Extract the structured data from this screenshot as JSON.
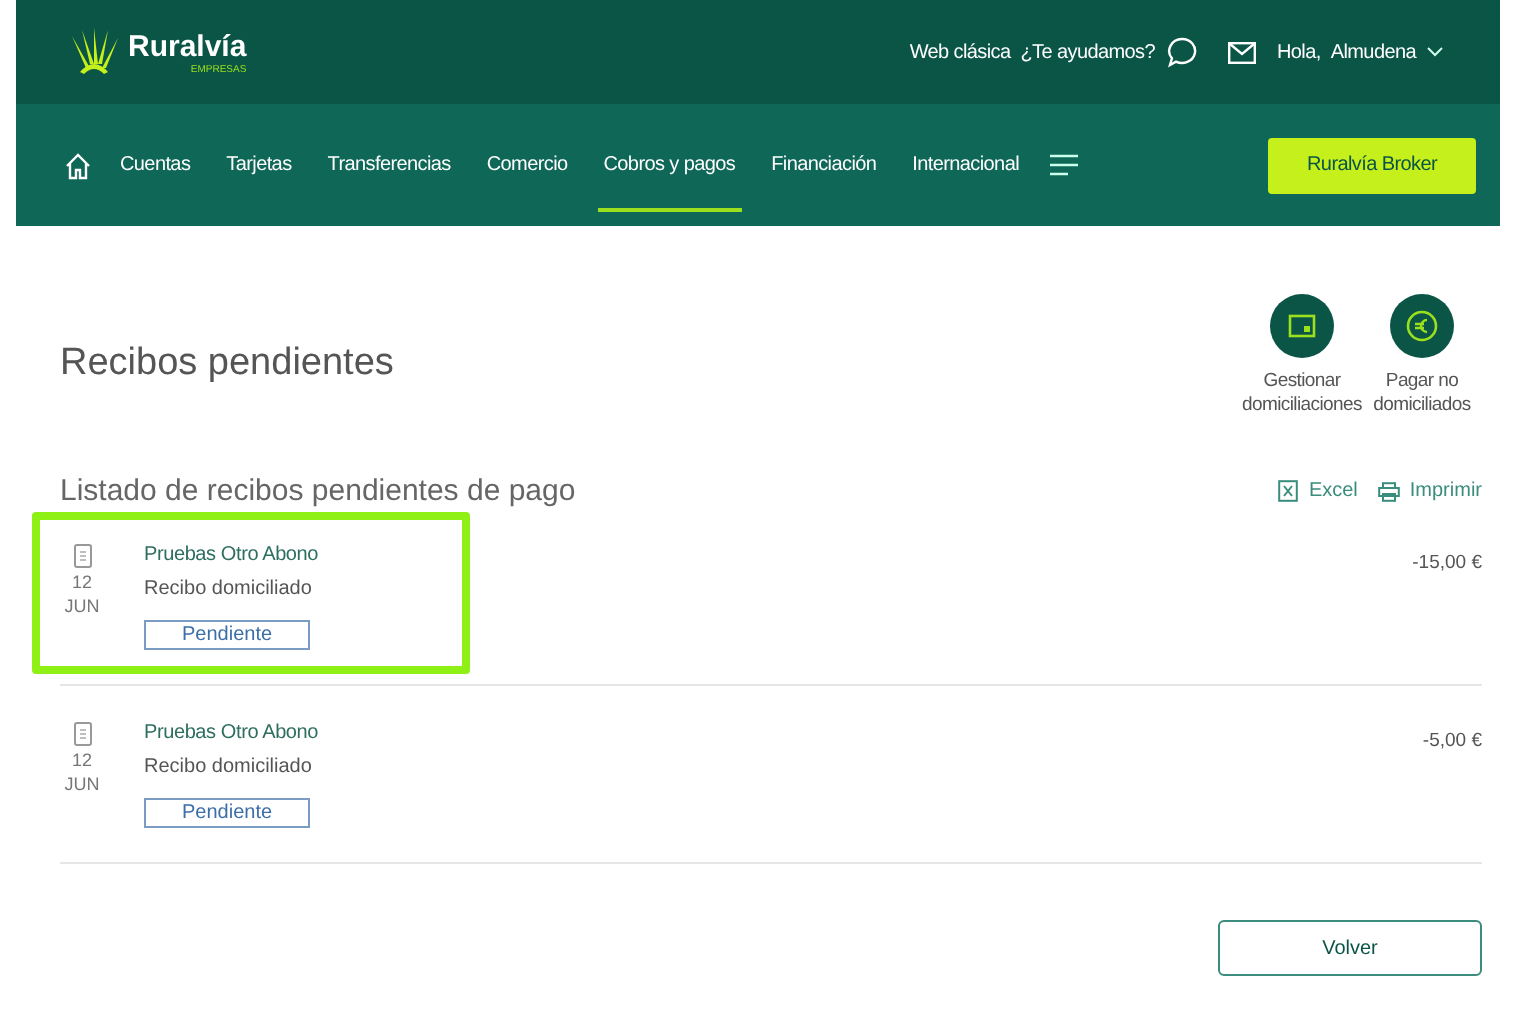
{
  "header": {
    "logo": "Ruralvía",
    "logo_sub": "EMPRESAS",
    "links": [
      "Web clásica",
      "¿Te ayudamos?"
    ],
    "greeting": "Hola,",
    "user": "Almudena"
  },
  "nav": {
    "items": [
      {
        "label": "Cuentas",
        "selected": false
      },
      {
        "label": "Tarjetas",
        "selected": false
      },
      {
        "label": "Transferencias",
        "selected": false
      },
      {
        "label": "Comercio",
        "selected": false
      },
      {
        "label": "Cobros y pagos",
        "selected": true
      },
      {
        "label": "Financiación",
        "selected": false
      },
      {
        "label": "Internacional",
        "selected": false
      }
    ],
    "button": "Ruralvía Broker"
  },
  "title": "Recibos pendientes",
  "actions": [
    {
      "kind": "card",
      "label": "Gestionar domiciliaciones"
    },
    {
      "kind": "euro",
      "label": "Pagar no domiciliados"
    }
  ],
  "subtitle": "Listado de recibos pendientes de pago",
  "exports": [
    {
      "kind": "excel",
      "label": "Excel"
    },
    {
      "kind": "print",
      "label": "Imprimir"
    }
  ],
  "receipts": [
    {
      "highlighted": true,
      "day": "12",
      "month": "JUN",
      "name": "Pruebas Otro Abono",
      "type": "Recibo domiciliado",
      "status": "Pendiente",
      "amount": "-15,00 €"
    },
    {
      "highlighted": false,
      "day": "12",
      "month": "JUN",
      "name": "Pruebas Otro Abono",
      "type": "Recibo domiciliado",
      "status": "Pendiente",
      "amount": "-5,00 €"
    }
  ],
  "back_button": "Volver"
}
